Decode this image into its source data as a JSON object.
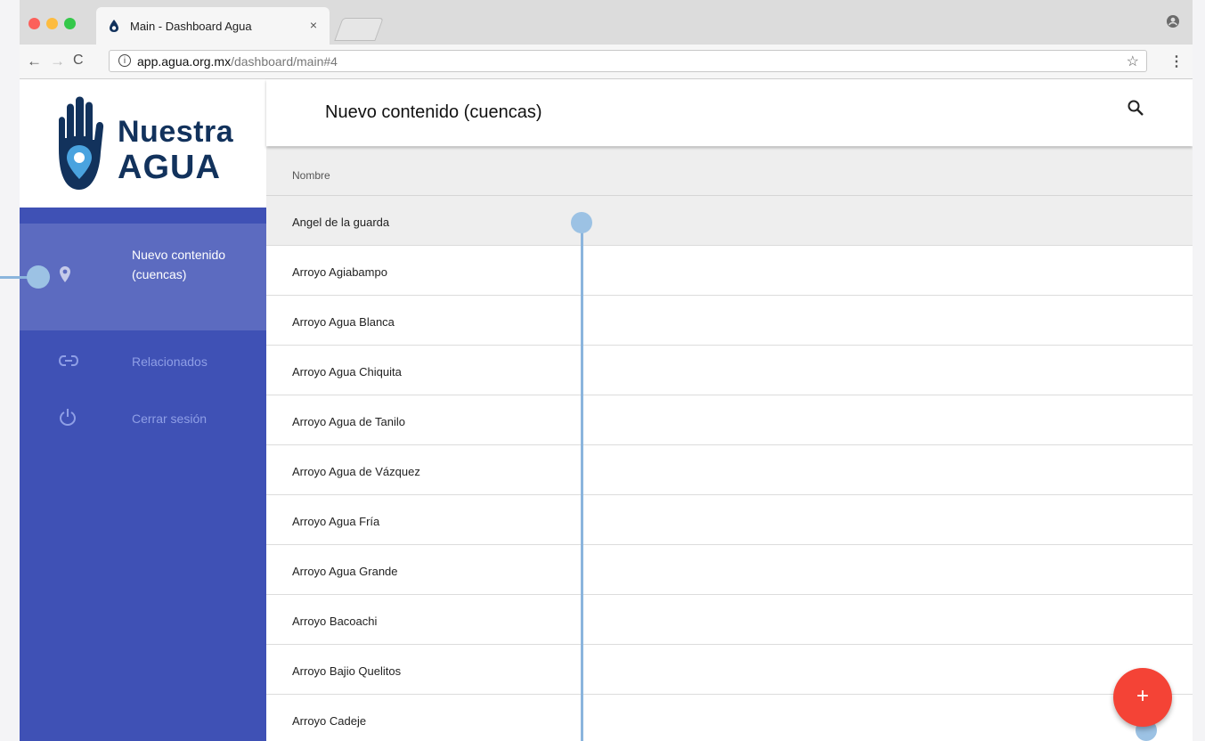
{
  "browser": {
    "tab_title": "Main - Dashboard Agua",
    "tab_close": "×",
    "url_host": "app.agua.org.mx",
    "url_path": "/dashboard/main#4",
    "info_glyph": "i",
    "star_glyph": "☆",
    "menu_glyph": "⋮",
    "back_glyph": "←",
    "forward_glyph": "→",
    "reload_glyph": "C"
  },
  "logo": {
    "line1": "Nuestra",
    "line2": "AGUA",
    "colors": {
      "navy": "#12325c",
      "light_blue": "#4aa3df"
    }
  },
  "sidebar": {
    "items": [
      {
        "label": "Nuevo contenido (cuencas)",
        "icon": "location-pin-icon",
        "active": true
      },
      {
        "label": "Relacionados",
        "icon": "link-icon",
        "active": false
      },
      {
        "label": "Cerrar sesión",
        "icon": "power-icon",
        "active": false
      }
    ],
    "colors": {
      "bg": "#3f51b5",
      "active_bg": "#5c6bc0",
      "inactive_text": "#8f9fe6"
    }
  },
  "main": {
    "title": "Nuevo contenido (cuencas)",
    "table": {
      "column": "Nombre",
      "rows": [
        "Angel de la guarda",
        "Arroyo Agiabampo",
        "Arroyo Agua Blanca",
        "Arroyo Agua Chiquita",
        "Arroyo Agua de Tanilo",
        "Arroyo Agua de Vázquez",
        "Arroyo Agua Fría",
        "Arroyo Agua Grande",
        "Arroyo Bacoachi",
        "Arroyo Bajio Quelitos",
        "Arroyo Cadeje"
      ]
    },
    "fab_label": "+",
    "fab_color": "#f44336"
  }
}
